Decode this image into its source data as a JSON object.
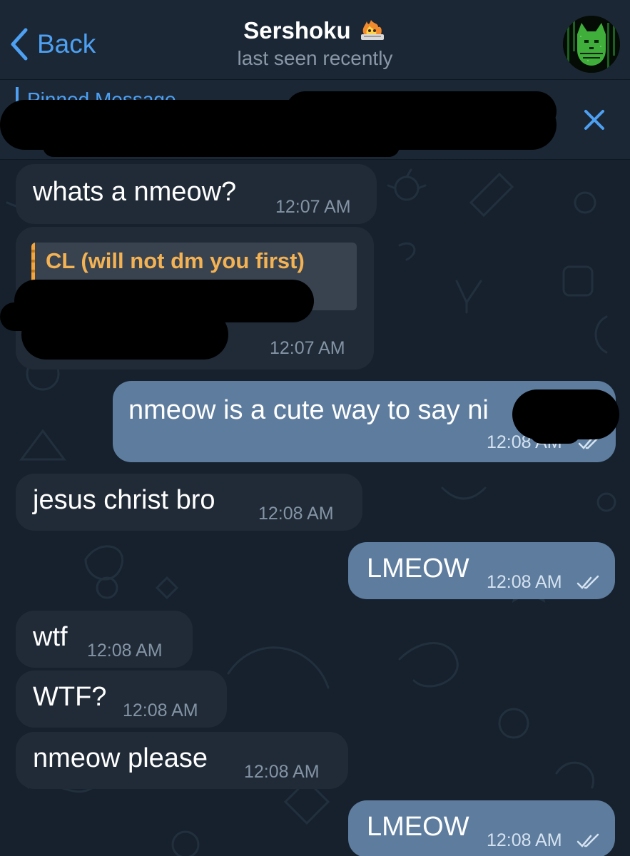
{
  "header": {
    "back_label": "Back",
    "title": "Sershoku",
    "status": "last seen recently"
  },
  "pinned": {
    "label": "Pinned Message"
  },
  "messages": [
    {
      "dir": "in",
      "text": "whats a nmeow?",
      "time": "12:07 AM"
    },
    {
      "dir": "in",
      "reply_name": "CL (will not dm you first)",
      "text": "",
      "time": "12:07 AM"
    },
    {
      "dir": "out",
      "text": "nmeow is a cute way to say ni",
      "time": "12:08 AM",
      "read": true
    },
    {
      "dir": "in",
      "text": "jesus christ bro",
      "time": "12:08 AM"
    },
    {
      "dir": "out",
      "text": "LMEOW",
      "time": "12:08 AM",
      "read": true
    },
    {
      "dir": "in",
      "text": "wtf",
      "time": "12:08 AM"
    },
    {
      "dir": "in",
      "text": "WTF?",
      "time": "12:08 AM"
    },
    {
      "dir": "in",
      "text": "nmeow please",
      "time": "12:08 AM"
    },
    {
      "dir": "out",
      "text": "LMEOW",
      "time": "12:08 AM",
      "read": true
    }
  ],
  "colors": {
    "accent": "#4da0f2",
    "incoming_bubble": "#202b37",
    "outgoing_bubble": "#5d7c9e",
    "reply_name": "#f3b253",
    "background": "#16212d"
  }
}
